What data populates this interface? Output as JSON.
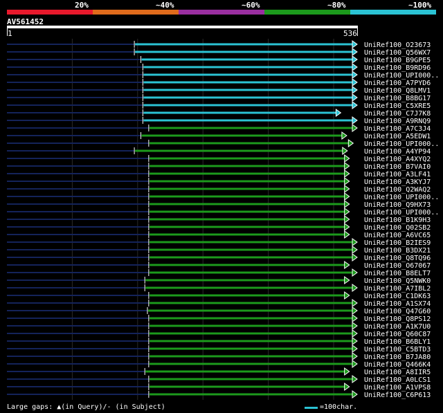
{
  "header": {
    "scale_segments": [
      {
        "label": "20%",
        "color": "#e8192c"
      },
      {
        "label": "~40%",
        "color": "#e06b1c"
      },
      {
        "label": "~60%",
        "color": "#9a2fa0"
      },
      {
        "label": "~80%",
        "color": "#1c9a1c"
      },
      {
        "label": "~100%",
        "color": "#2bc3d4"
      }
    ]
  },
  "query": {
    "name": "AV561452",
    "start": "1",
    "end": "536"
  },
  "footer": {
    "gaps_label": "Large gaps: ▲(in Query)/- (in Subject)",
    "scale_label": "=100char."
  },
  "chart_data": {
    "type": "alignment",
    "query_length": 536,
    "colors": {
      "cyan": "#2bc3d4",
      "green": "#1c9a1c",
      "dim": "#14235a"
    },
    "hits": [
      {
        "label": "UniRef100_O23673",
        "start": 195,
        "end": 536,
        "color": "cyan"
      },
      {
        "label": "UniRef100_Q56WX7",
        "start": 195,
        "end": 536,
        "color": "cyan"
      },
      {
        "label": "UniRef100_B9GPE5",
        "start": 205,
        "end": 536,
        "color": "cyan"
      },
      {
        "label": "UniRef100_B9RD96",
        "start": 208,
        "end": 536,
        "color": "cyan"
      },
      {
        "label": "UniRef100_UPI000..",
        "start": 208,
        "end": 536,
        "color": "cyan"
      },
      {
        "label": "UniRef100_A7PYD6",
        "start": 208,
        "end": 536,
        "color": "cyan"
      },
      {
        "label": "UniRef100_Q8LMV1",
        "start": 208,
        "end": 536,
        "color": "cyan"
      },
      {
        "label": "UniRef100_B8BG17",
        "start": 208,
        "end": 536,
        "color": "cyan"
      },
      {
        "label": "UniRef100_C5XRE5",
        "start": 208,
        "end": 536,
        "color": "cyan"
      },
      {
        "label": "UniRef100_C7J7K8",
        "start": 208,
        "end": 511,
        "color": "cyan"
      },
      {
        "label": "UniRef100_A9RNQ9",
        "start": 208,
        "end": 536,
        "color": "cyan"
      },
      {
        "label": "UniRef100_A7C3J4",
        "start": 217,
        "end": 536,
        "color": "green"
      },
      {
        "label": "UniRef100_A5EDW1",
        "start": 205,
        "end": 520,
        "color": "green"
      },
      {
        "label": "UniRef100_UPI000..",
        "start": 217,
        "end": 530,
        "color": "green"
      },
      {
        "label": "UniRef100_A4YP94",
        "start": 195,
        "end": 521,
        "color": "green"
      },
      {
        "label": "UniRef100_A4XYQ2",
        "start": 217,
        "end": 524,
        "color": "green"
      },
      {
        "label": "UniRef100_B7VAI0",
        "start": 217,
        "end": 524,
        "color": "green"
      },
      {
        "label": "UniRef100_A3LF41",
        "start": 217,
        "end": 524,
        "color": "green"
      },
      {
        "label": "UniRef100_A3KYJ7",
        "start": 217,
        "end": 524,
        "color": "green"
      },
      {
        "label": "UniRef100_Q2WAQ2",
        "start": 217,
        "end": 524,
        "color": "green"
      },
      {
        "label": "UniRef100_UPI000..",
        "start": 217,
        "end": 524,
        "color": "green"
      },
      {
        "label": "UniRef100_Q9HX73",
        "start": 217,
        "end": 524,
        "color": "green"
      },
      {
        "label": "UniRef100_UPI000..",
        "start": 217,
        "end": 524,
        "color": "green"
      },
      {
        "label": "UniRef100_B1K9H3",
        "start": 217,
        "end": 524,
        "color": "green"
      },
      {
        "label": "UniRef100_Q02SB2",
        "start": 217,
        "end": 524,
        "color": "green"
      },
      {
        "label": "UniRef100_A6VC65",
        "start": 217,
        "end": 524,
        "color": "green"
      },
      {
        "label": "UniRef100_B2IES9",
        "start": 217,
        "end": 536,
        "color": "green"
      },
      {
        "label": "UniRef100_B3DX21",
        "start": 217,
        "end": 536,
        "color": "green"
      },
      {
        "label": "UniRef100_Q8TQ96",
        "start": 217,
        "end": 536,
        "color": "green"
      },
      {
        "label": "UniRef100_O67067",
        "start": 217,
        "end": 524,
        "color": "green"
      },
      {
        "label": "UniRef100_B8ELT7",
        "start": 217,
        "end": 536,
        "color": "green"
      },
      {
        "label": "UniRef100_Q5NWK0",
        "start": 211,
        "end": 524,
        "color": "green"
      },
      {
        "label": "UniRef100_A7IBL2",
        "start": 211,
        "end": 536,
        "color": "green"
      },
      {
        "label": "UniRef100_C1DK63",
        "start": 217,
        "end": 524,
        "color": "green"
      },
      {
        "label": "UniRef100_A1SX74",
        "start": 217,
        "end": 536,
        "color": "green"
      },
      {
        "label": "UniRef100_Q47G60",
        "start": 215,
        "end": 536,
        "color": "green"
      },
      {
        "label": "UniRef100_Q8PS12",
        "start": 217,
        "end": 536,
        "color": "green"
      },
      {
        "label": "UniRef100_A1K7U0",
        "start": 217,
        "end": 536,
        "color": "green"
      },
      {
        "label": "UniRef100_Q60C87",
        "start": 217,
        "end": 536,
        "color": "green"
      },
      {
        "label": "UniRef100_B6BLY1",
        "start": 217,
        "end": 536,
        "color": "green"
      },
      {
        "label": "UniRef100_C5BTD3",
        "start": 217,
        "end": 536,
        "color": "green"
      },
      {
        "label": "UniRef100_B7JA80",
        "start": 217,
        "end": 536,
        "color": "green"
      },
      {
        "label": "UniRef100_Q466K4",
        "start": 217,
        "end": 536,
        "color": "green"
      },
      {
        "label": "UniRef100_A8IIR5",
        "start": 211,
        "end": 524,
        "color": "green"
      },
      {
        "label": "UniRef100_A0LCS1",
        "start": 217,
        "end": 536,
        "color": "green"
      },
      {
        "label": "UniRef100_A1VPS8",
        "start": 217,
        "end": 524,
        "color": "green"
      },
      {
        "label": "UniRef100_C6P613",
        "start": 217,
        "end": 536,
        "color": "green"
      }
    ]
  }
}
